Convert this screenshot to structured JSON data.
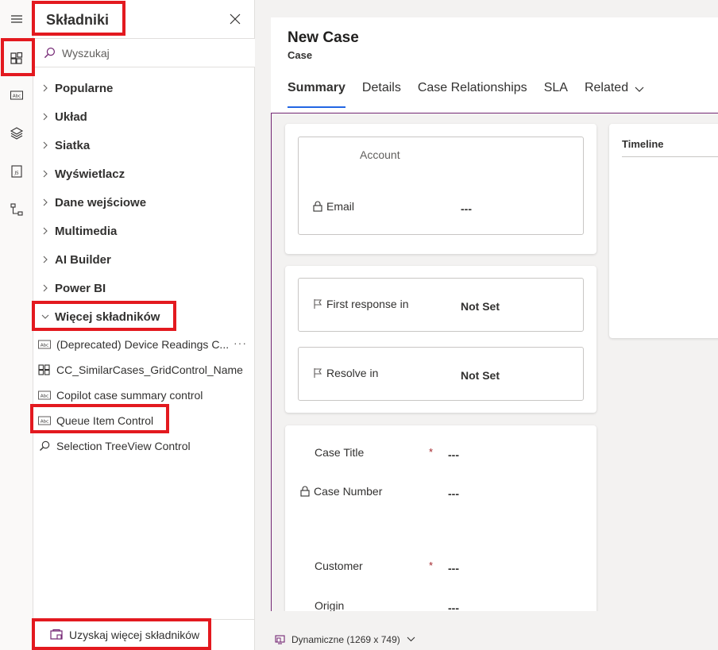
{
  "rail": {
    "items": [
      "menu-icon",
      "components-icon",
      "text-field-icon",
      "layers-icon",
      "js-file-icon",
      "tree-view-icon"
    ]
  },
  "panel": {
    "title": "Składniki",
    "search_placeholder": "Wyszukaj",
    "categories": [
      "Popularne",
      "Układ",
      "Siatka",
      "Wyświetlacz",
      "Dane wejściowe",
      "Multimedia",
      "AI Builder",
      "Power BI"
    ],
    "expanded_category": "Więcej składników",
    "components": [
      "(Deprecated) Device Readings C...",
      "CC_SimilarCases_GridControl_Name",
      "Copilot case summary control",
      "Queue Item Control",
      "Selection TreeView Control"
    ],
    "more_dots": "···",
    "footer_label": "Uzyskaj więcej składników"
  },
  "form": {
    "title": "New Case",
    "entity": "Case",
    "tabs": [
      "Summary",
      "Details",
      "Case Relationships",
      "SLA",
      "Related"
    ],
    "account_label": "Account",
    "email_label": "Email",
    "email_value": "---",
    "first_response_label": "First response in",
    "first_response_value": "Not Set",
    "resolve_label": "Resolve in",
    "resolve_value": "Not Set",
    "case_title_label": "Case Title",
    "case_title_value": "---",
    "case_number_label": "Case Number",
    "case_number_value": "---",
    "customer_label": "Customer",
    "customer_value": "---",
    "origin_label": "Origin",
    "origin_value": "---",
    "required_mark": "*",
    "timeline_title": "Timeline"
  },
  "statusbar": {
    "viewport_label": "Dynamiczne (1269 x 749)"
  },
  "colors": {
    "highlight": "#e3191f",
    "tab_underline": "#2266e3",
    "form_border": "#742774",
    "required": "#a4262c"
  }
}
